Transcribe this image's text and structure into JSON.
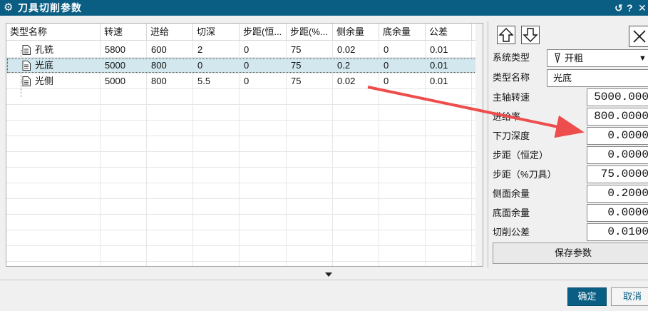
{
  "window": {
    "title": "刀具切削参数",
    "reset_glyph": "↺",
    "help_glyph": "?",
    "close_glyph": "✕"
  },
  "grid": {
    "columns": [
      "类型名称",
      "转速",
      "进给",
      "切深",
      "步距(恒...",
      "步距(%...",
      "侧余量",
      "底余量",
      "公差"
    ],
    "rows": [
      {
        "name": "孔铣",
        "speed": "5800",
        "feed": "600",
        "depth": "2",
        "step_const": "0",
        "step_pct": "75",
        "side": "0.02",
        "bottom": "0",
        "tol": "0.01",
        "selected": false
      },
      {
        "name": "光底",
        "speed": "5000",
        "feed": "800",
        "depth": "0",
        "step_const": "0",
        "step_pct": "75",
        "side": "0.2",
        "bottom": "0",
        "tol": "0.01",
        "selected": true
      },
      {
        "name": "光侧",
        "speed": "5000",
        "feed": "800",
        "depth": "5.5",
        "step_const": "0",
        "step_pct": "75",
        "side": "0.02",
        "bottom": "0",
        "tol": "0.01",
        "selected": false
      }
    ]
  },
  "panel": {
    "system_type_label": "系统类型",
    "system_type_value": "开粗",
    "type_name_label": "类型名称",
    "type_name_value": "光底",
    "spindle_label": "主轴转速",
    "spindle_value": "5000.000",
    "feed_label": "进给率",
    "feed_value": "800.0000",
    "depth_label": "下刀深度",
    "depth_value": "0.0000",
    "step_const_label": "步距（恒定）",
    "step_const_value": "0.0000",
    "step_pct_label": "步距（%刀具）",
    "step_pct_value": "75.0000",
    "side_label": "侧面余量",
    "side_value": "0.2000",
    "bottom_label": "底面余量",
    "bottom_value": "0.0000",
    "tol_label": "切削公差",
    "tol_value": "0.0100",
    "save_label": "保存参数"
  },
  "footer": {
    "ok_label": "确定",
    "cancel_label": "取消"
  },
  "colors": {
    "title_bar": "#0a5e84",
    "selected_row": "#d2e8ee",
    "annotation_arrow": "#ee4d4d"
  }
}
